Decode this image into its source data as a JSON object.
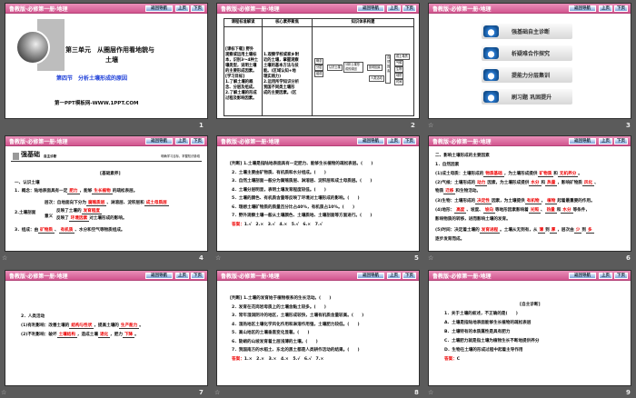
{
  "header": {
    "title": "鲁教版·必修第一册·地理",
    "nav_back": "返回导航",
    "nav_prev": "上页",
    "nav_next": "下页"
  },
  "slides": [
    {
      "number": "1",
      "unit_title": "第三单元　从圈层作用看地貌与",
      "unit_title2": "土壤",
      "section": "第四节　分析土壤形成的原因",
      "site": "第一PPT模板网-WWW.1PPT.COM"
    },
    {
      "number": "2",
      "headers": [
        "课程标准解读",
        "核心素养聚焦",
        "知识体系构建"
      ],
      "col1": [
        "[课标下载] 野外",
        "观察或运用土壤标",
        "本，识别3～4种土",
        "壤类型，说明土壤",
        "的主要形成因素。",
        "[学习目标]",
        "1.了解土壤的概",
        "念、分层及组成。",
        "2.了解土壤的形成",
        "过程及影响因素。"
      ],
      "col2": [
        "1.观察学校或家乡附",
        "近的土壤，掌握观察",
        "土壤的基本方法与技",
        "能。(区域认知+地",
        "理实践力)",
        "2.运用所学知识分析",
        "我国不同类土壤形",
        "成的主要因素。(区"
      ],
      "diagram": {
        "left": [
          "概念",
          "分层",
          "组成"
        ],
        "center": "认识土壤",
        "main": "分析土壤形成的原因",
        "factors": "影响因素",
        "natural": "自然因素",
        "human": "人类活动",
        "natural_items": [
          "成土母质",
          "气候",
          "生物",
          "地形",
          "时间"
        ]
      }
    },
    {
      "number": "3",
      "menu": [
        "强基础自主诊断",
        "析疑难合作探究",
        "提能力分层集训",
        "刷习题 巩固提升"
      ]
    },
    {
      "number": "4",
      "banner": "强基础",
      "banner_sub": "自主诊断",
      "banner_right": "明确学习目标，掌握知识脉络",
      "heading": "[基础素养]",
      "lines": {
        "s1": "一、认识土壤",
        "p1a": "1．概念：陆地表面具有一定",
        "p1b": "肥力",
        "p1c": "，能够",
        "p1d": "生长植物",
        "p1e": "的疏松表层。",
        "p2": "2.土壤剖面",
        "p2a": "层次：自地面向下分为",
        "p2b": "腐殖质层",
        "p2c": "、淋溶层、淀积层和",
        "p2d": "成土母质层",
        "p2e": "意义",
        "p2f": "反映了土壤的",
        "p2g": "发育程度",
        "p2h": "反映了",
        "p2i": "环境因素",
        "p2j": "对土壤形成的影响。",
        "p3a": "3．组成：由",
        "p3b": "矿物质",
        "p3c": "有机质",
        "p3d": "、水分和空气等物质组成。"
      }
    },
    {
      "number": "5",
      "items": [
        "[判断] 1.土壤是指陆地表面具有一定肥力、能够生长植物的疏松表层。(　　)",
        "2．土壤主要由矿物质、有机质和水分组成。(　　)",
        "3．自然土壤剖面一般分为腐殖质层、淋溶层、淀积层和成土母质层。(　　)",
        "4．土壤分层明显，表明土壤发育程度较低。(　　)",
        "5．土壤的颜色、有机质含量等反映了环境对土壤形成的影响。(　　)",
        "6．理想土壤矿物质的质量百分比占40%，有机质占10%。(　　)",
        "7．野外观察土壤一般从土壤颜色、土壤质地、土壤剖面等方面进行。(　　)"
      ],
      "answer_label": "答案：",
      "answer": "1.√　2.×　3.√　4.×　5.√　6.×　7.√"
    },
    {
      "number": "6",
      "s": "二、影响土壤形成的主要因素",
      "s1": "1．自然因素",
      "l1": [
        "(1)成土母质：土壤形成的",
        "物质基础",
        "，为土壤形成提供",
        "矿物质",
        "和",
        "无机养分",
        "。"
      ],
      "l2": [
        "(2)气候：土壤形成的",
        "动力",
        "因素，为土壤形成提供",
        "水分",
        "和",
        "热量",
        "，影响矿物质",
        "风化",
        "、"
      ],
      "l2b": [
        "物质",
        "迁移",
        "和生物活动。"
      ],
      "l3": [
        "(3)生物：土壤形成的",
        "决定性",
        "因素，为土壤提供",
        "有机物",
        "，",
        "植物",
        "起着最重要的作用。"
      ],
      "l4": [
        "(4)地形：",
        "高度",
        "、坡度、",
        "坡向",
        "等地形因素影响着",
        "光照",
        "、",
        "热量",
        "和",
        "水分",
        "等条件，"
      ],
      "l4b": "影响物质的转移，进而影响土壤的发育。",
      "l5": [
        "(5)时间：决定着土壤的",
        "发育进程",
        "。土壤从无到有，从",
        "薄",
        "到",
        "厚",
        "，层次由",
        "少",
        "到",
        "多"
      ],
      "l5b": "逐步发育而成。"
    },
    {
      "number": "7",
      "s": "2．人类活动",
      "l1": [
        "(1)有利影响：改善土壤的",
        "结构与性状",
        "，提高土壤的",
        "生产能力",
        "。"
      ],
      "l2": [
        "(2)不利影响：破坏",
        "土壤结构",
        "，造成土壤",
        "退化",
        "，肥力",
        "下降",
        "。"
      ]
    },
    {
      "number": "8",
      "items": [
        "[判断] 1.土壤的发育始于植物根系的生长活动。(　　)",
        "2．发育在花岗岩母质上的土壤含黏土较多。(　　)",
        "3．常年湿润阴冷的地区，土壤形成较快，土壤有机质含量较高。(　　)",
        "4．湿热地区土壤化学风化作用和淋溶作用强，土壤肥力较低。(　　)",
        "5．高山地区的土壤垂直变化显著。(　　)",
        "6．陡峭的山坡发育着土层浅薄的土壤。(　　)",
        "7．我国南方的水稻土、东北的黑土都是人类耕作活动的结果。(　　)"
      ],
      "answer_label": "答案：",
      "answer": "1.×　2.×　3.×　4.×　5.√　6.√　7.×"
    },
    {
      "number": "9",
      "heading": "[自主诊断]",
      "q": "1．关于土壤的叙述，不正确的是(　　)",
      "options": [
        "A．土壤是指陆地表面能够生长植物的疏松表层",
        "B．土壤特有的本质属性是具有肥力",
        "C．土壤肥力就是指土壤为植物生长不断地提供养分",
        "D．生物在土壤的形成过程中起着主导作用"
      ],
      "answer_label": "答案：",
      "answer": "C"
    }
  ]
}
